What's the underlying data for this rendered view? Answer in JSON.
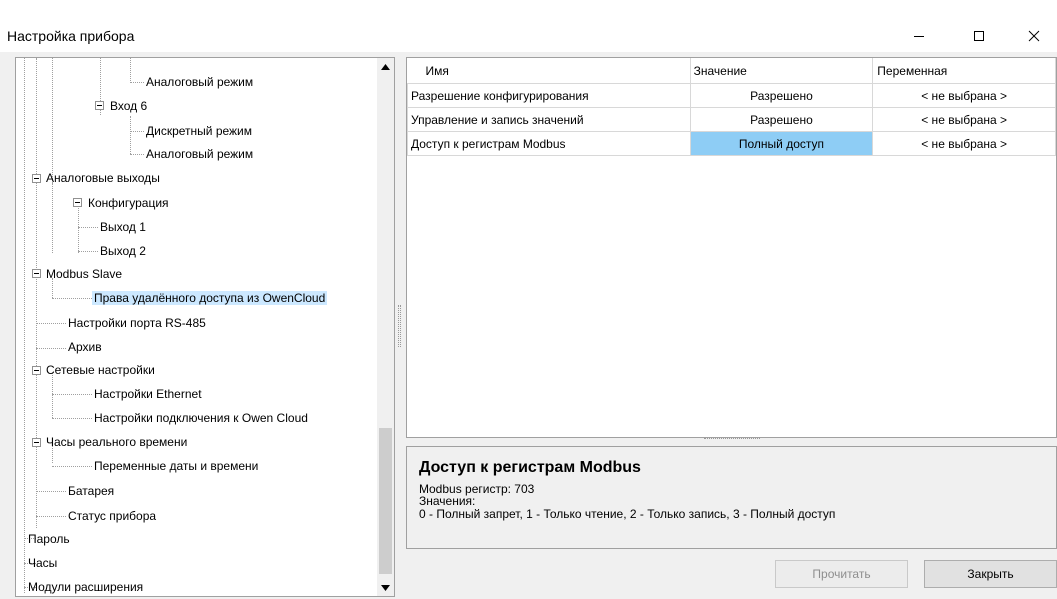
{
  "window": {
    "title": "Настройка прибора",
    "controls": {
      "minimize": "minimize-icon",
      "maximize": "maximize-icon",
      "close": "close-icon"
    }
  },
  "tree": {
    "items": [
      {
        "label": "Аналоговый режим"
      },
      {
        "label": "Вход 6"
      },
      {
        "label": "Дискретный режим"
      },
      {
        "label": "Аналоговый режим"
      },
      {
        "label": "Аналоговые выходы"
      },
      {
        "label": "Конфигурация"
      },
      {
        "label": "Выход 1"
      },
      {
        "label": "Выход 2"
      },
      {
        "label": "Modbus Slave"
      },
      {
        "label": "Права удалённого доступа из OwenCloud",
        "selected": true
      },
      {
        "label": "Настройки порта RS-485"
      },
      {
        "label": "Архив"
      },
      {
        "label": "Сетевые настройки"
      },
      {
        "label": "Настройки Ethernet"
      },
      {
        "label": "Настройки подключения к Owen Cloud"
      },
      {
        "label": "Часы реального времени"
      },
      {
        "label": "Переменные даты и времени"
      },
      {
        "label": "Батарея"
      },
      {
        "label": "Статус прибора"
      },
      {
        "label": "Пароль"
      },
      {
        "label": "Часы"
      },
      {
        "label": "Модули расширения"
      }
    ]
  },
  "grid": {
    "headers": [
      "Имя",
      "Значение",
      "Переменная"
    ],
    "rows": [
      {
        "name": "Разрешение конфигурирования",
        "value": "Разрешено",
        "variable": "< не выбрана >"
      },
      {
        "name": "Управление и запись значений",
        "value": "Разрешено",
        "variable": "< не выбрана >"
      },
      {
        "name": "Доступ к регистрам Modbus",
        "value": "Полный доступ",
        "variable": "< не выбрана >"
      }
    ]
  },
  "info": {
    "heading": "Доступ к регистрам Modbus",
    "line1": "Modbus регистр: 703",
    "line2": "Значения:",
    "line3": "0 - Полный запрет, 1 - Только чтение, 2 - Только запись, 3 - Полный доступ"
  },
  "buttons": {
    "read": "Прочитать",
    "close": "Закрыть"
  },
  "colors": {
    "selection": "#cce8ff",
    "highlight_cell": "#8ecdf5"
  }
}
